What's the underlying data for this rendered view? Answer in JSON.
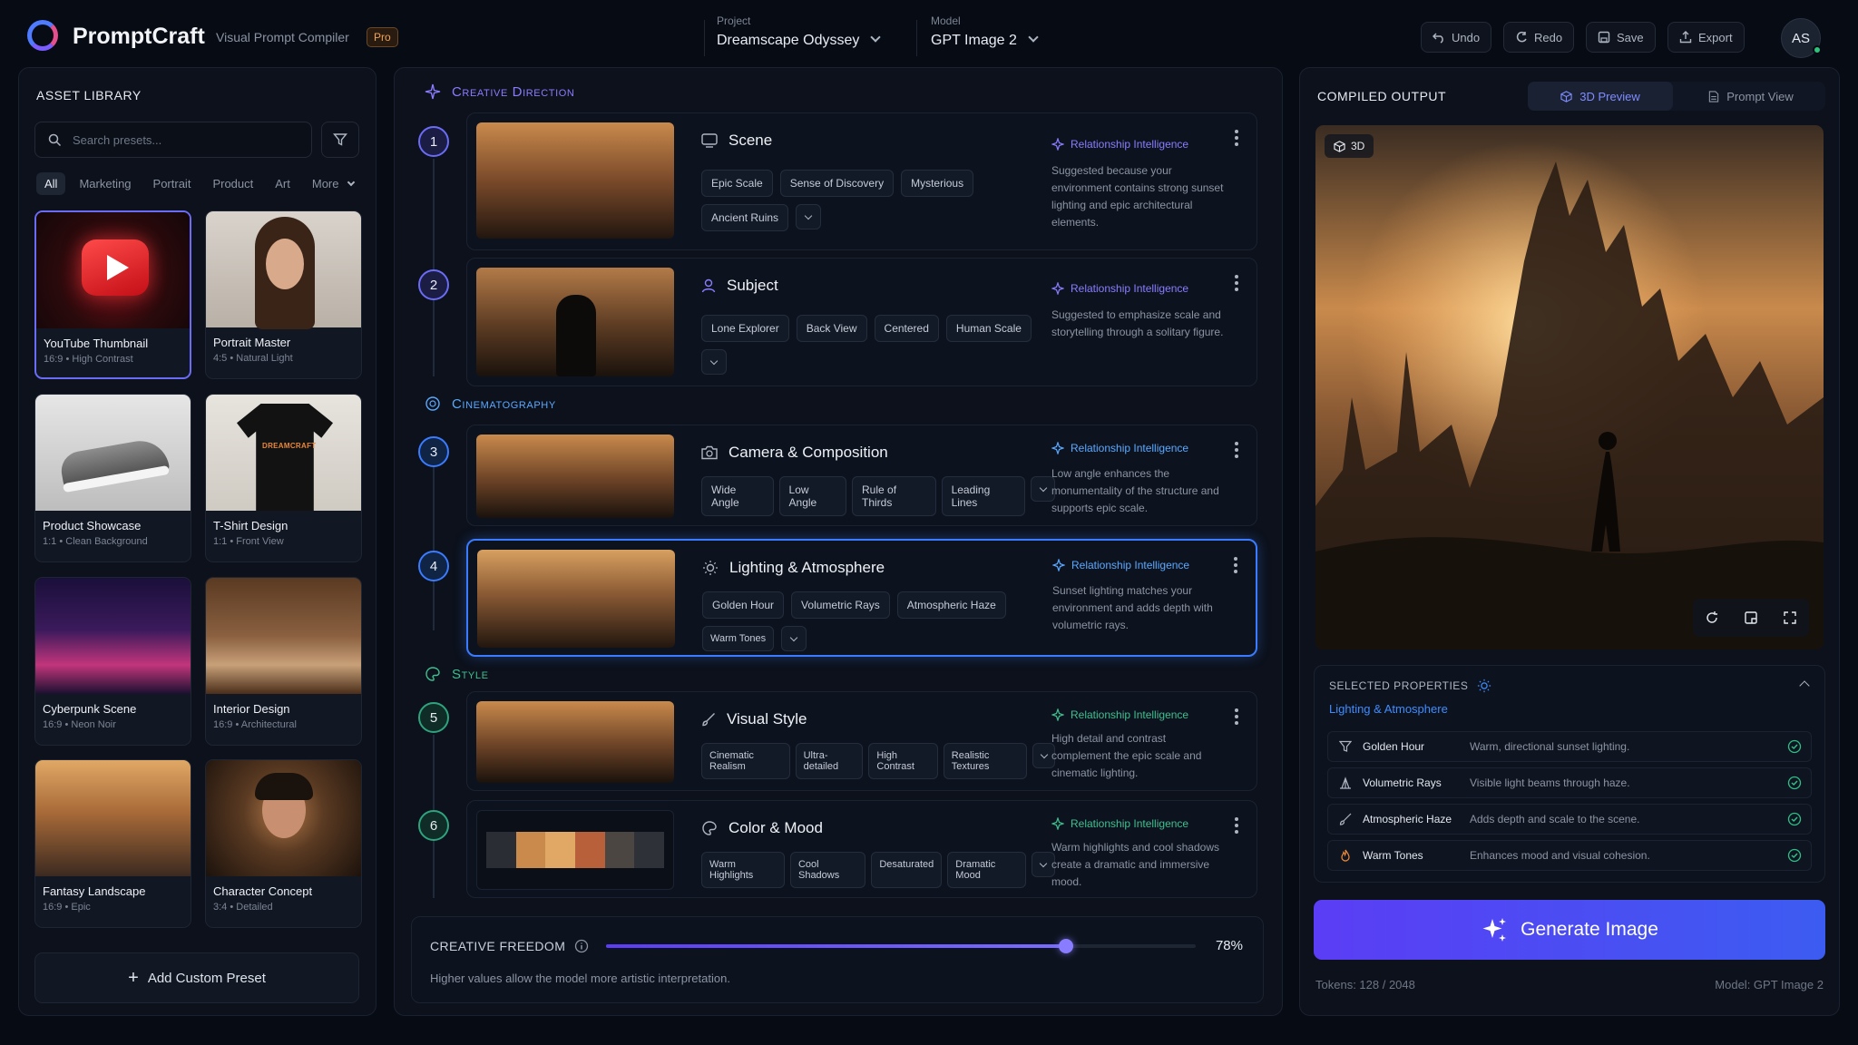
{
  "header": {
    "brand": "PromptCraft",
    "subtitle": "Visual Prompt Compiler",
    "badge": "Pro",
    "project_label": "Project",
    "project_value": "Dreamscape Odyssey",
    "model_label": "Model",
    "model_value": "GPT Image 2",
    "undo": "Undo",
    "redo": "Redo",
    "save": "Save",
    "export": "Export",
    "avatar": "AS"
  },
  "library": {
    "title": "ASSET LIBRARY",
    "search_placeholder": "Search presets...",
    "filters": [
      "All",
      "Marketing",
      "Portrait",
      "Product",
      "Art",
      "More"
    ],
    "cards": [
      {
        "title": "YouTube Thumbnail",
        "ratio": "16:9",
        "tag": "High Contrast"
      },
      {
        "title": "Portrait Master",
        "ratio": "4:5",
        "tag": "Natural Light"
      },
      {
        "title": "Product Showcase",
        "ratio": "1:1",
        "tag": "Clean Background"
      },
      {
        "title": "T-Shirt Design",
        "ratio": "1:1",
        "tag": "Front View"
      },
      {
        "title": "Cyberpunk Scene",
        "ratio": "16:9",
        "tag": "Neon Noir"
      },
      {
        "title": "Interior Design",
        "ratio": "16:9",
        "tag": "Architectural"
      },
      {
        "title": "Fantasy Landscape",
        "ratio": "16:9",
        "tag": "Epic"
      },
      {
        "title": "Character Concept",
        "ratio": "3:4",
        "tag": "Detailed"
      }
    ],
    "tshirt_print": "DREAMCRAFT",
    "add_preset": "Add Custom Preset"
  },
  "sections": {
    "creative_direction": "Creative Direction",
    "cinematography": "Cinematography",
    "style": "Style"
  },
  "ri_label": "Relationship Intelligence",
  "steps": [
    {
      "num": "1",
      "title": "Scene",
      "tags": [
        "Epic Scale",
        "Sense of Discovery",
        "Mysterious",
        "Ancient Ruins"
      ],
      "reason": "Suggested because your environment contains strong sunset lighting and epic architectural elements."
    },
    {
      "num": "2",
      "title": "Subject",
      "tags": [
        "Lone Explorer",
        "Back View",
        "Centered",
        "Human Scale"
      ],
      "reason": "Suggested to emphasize scale and storytelling through a solitary figure."
    },
    {
      "num": "3",
      "title": "Camera & Composition",
      "tags": [
        "Wide Angle",
        "Low Angle",
        "Rule of Thirds",
        "Leading Lines"
      ],
      "reason": "Low angle enhances the monumentality of the structure and supports epic scale."
    },
    {
      "num": "4",
      "title": "Lighting & Atmosphere",
      "tags": [
        "Golden Hour",
        "Volumetric Rays",
        "Atmospheric Haze",
        "Warm Tones"
      ],
      "reason": "Sunset lighting matches your environment and adds depth with volumetric rays."
    },
    {
      "num": "5",
      "title": "Visual Style",
      "tags": [
        "Cinematic Realism",
        "Ultra-detailed",
        "High Contrast",
        "Realistic Textures"
      ],
      "reason": "High detail and contrast complement the epic scale and cinematic lighting."
    },
    {
      "num": "6",
      "title": "Color & Mood",
      "tags": [
        "Warm Highlights",
        "Cool Shadows",
        "Desaturated",
        "Dramatic Mood"
      ],
      "reason": "Warm highlights and cool shadows create a dramatic and immersive mood."
    }
  ],
  "palette": [
    "#2a2d34",
    "#c98a4c",
    "#e1a865",
    "#b8603a",
    "#4b4642",
    "#2e3138"
  ],
  "freedom": {
    "label": "CREATIVE FREEDOM",
    "value": 78,
    "value_text": "78%",
    "help": "Higher values allow the model more artistic interpretation."
  },
  "output": {
    "title": "COMPILED OUTPUT",
    "tab_3d": "3D Preview",
    "tab_prompt": "Prompt View",
    "badge_3d": "3D",
    "selected_title": "SELECTED PROPERTIES",
    "selected_group": "Lighting & Atmosphere",
    "properties": [
      {
        "name": "Golden Hour",
        "desc": "Warm, directional sunset lighting."
      },
      {
        "name": "Volumetric Rays",
        "desc": "Visible light beams through haze."
      },
      {
        "name": "Atmospheric Haze",
        "desc": "Adds depth and scale to the scene."
      },
      {
        "name": "Warm Tones",
        "desc": "Enhances mood and visual cohesion."
      }
    ],
    "generate": "Generate Image",
    "tokens": "Tokens: 128 / 2048",
    "model_note": "Model: GPT Image 2"
  },
  "colors": {
    "accent": "#6a6cf6",
    "intel_purple": "#8a7cff",
    "intel_green": "#3fbf8f",
    "link_blue": "#3f8cff",
    "ok_green": "#2fbf86"
  }
}
